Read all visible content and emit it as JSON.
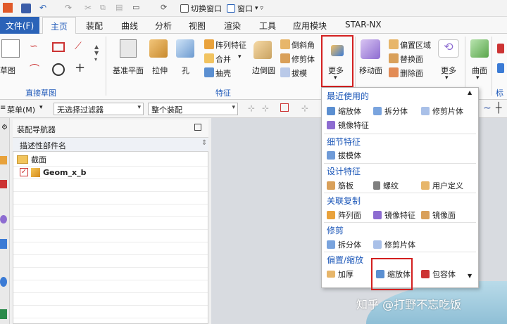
{
  "titlebar": {
    "switch_window": "切换窗口",
    "window_menu": "窗口",
    "window_arrow": "▾ ▿"
  },
  "menu": {
    "file": "文件(F)",
    "tabs": [
      "主页",
      "装配",
      "曲线",
      "分析",
      "视图",
      "渲染",
      "工具",
      "应用模块",
      "STAR-NX"
    ]
  },
  "ribbon": {
    "sketch": "草图",
    "direct_sketch": "直接草图",
    "datum_plane": "基准平面",
    "extrude": "拉伸",
    "hole": "孔",
    "pattern_feature": "阵列特征",
    "unite": "合并",
    "shell": "抽壳",
    "edge_blend": "边倒圆",
    "chamfer": "倒斜角",
    "trim_body": "修剪体",
    "draft": "拔模",
    "more": "更多",
    "move_face": "移动面",
    "offset_region": "偏置区域",
    "replace_face": "替换面",
    "delete_face": "删除面",
    "more2": "更多",
    "surface": "曲面",
    "feature_group": "特征",
    "std_group": "标"
  },
  "toolbar": {
    "menu": "菜单(M)",
    "filter": "无选择过滤器",
    "scope": "整个装配"
  },
  "navigator": {
    "title": "装配导航器",
    "column": "描述性部件名",
    "rows": [
      "截面",
      "Geom_x_b"
    ]
  },
  "dropdown": {
    "groups": [
      {
        "title": "最近使用的",
        "items": [
          "缩放体",
          "拆分体",
          "修剪片体",
          "镜像特征"
        ]
      },
      {
        "title": "细节特征",
        "items": [
          "拔模体"
        ]
      },
      {
        "title": "设计特征",
        "items": [
          "筋板",
          "螺纹",
          "用户定义"
        ]
      },
      {
        "title": "关联复制",
        "items": [
          "阵列面",
          "镜像特征",
          "镜像面"
        ]
      },
      {
        "title": "修剪",
        "items": [
          "拆分体",
          "修剪片体"
        ]
      },
      {
        "title": "偏置/缩放",
        "items": [
          "加厚",
          "缩放体",
          "包容体"
        ]
      }
    ]
  },
  "watermark": "知乎 @打野不忘吃饭",
  "colors": {
    "accent": "#1c57b8",
    "file_tab": "#2b63b8",
    "highlight": "#d32020"
  }
}
